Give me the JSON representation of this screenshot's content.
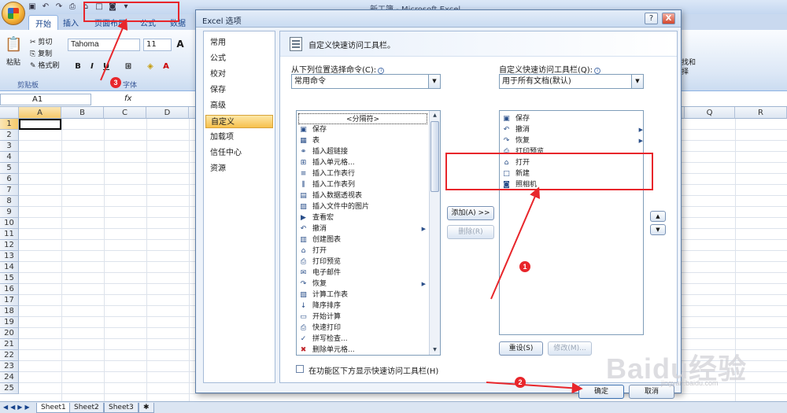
{
  "excel": {
    "title": "新工簿 - Microsoft Excel",
    "tabs": [
      "开始",
      "插入",
      "页面布局",
      "公式",
      "数据"
    ],
    "clipboard": {
      "paste": "粘贴",
      "cut": "剪切",
      "copy": "复制",
      "painter": "格式刷",
      "group": "剪贴板"
    },
    "font": {
      "name": "Tahoma",
      "size": "11",
      "group": "字体"
    },
    "ribbon_right": [
      "找和",
      "择"
    ],
    "name_box": "A1",
    "fx": "fx",
    "columns": [
      "A",
      "B",
      "C",
      "D",
      "Q",
      "R"
    ],
    "rows": [
      "1",
      "2",
      "3",
      "4",
      "5",
      "6",
      "7",
      "8",
      "9",
      "10",
      "11",
      "12",
      "13",
      "14",
      "15",
      "16",
      "17",
      "18",
      "19",
      "20",
      "21",
      "22",
      "23",
      "24",
      "25"
    ],
    "sheets": [
      "Sheet1",
      "Sheet2",
      "Sheet3"
    ]
  },
  "dialog": {
    "title": "Excel 选项",
    "help": "?",
    "close": "X",
    "nav": [
      "常用",
      "公式",
      "校对",
      "保存",
      "高级",
      "自定义",
      "加载项",
      "信任中心",
      "资源"
    ],
    "selected_nav": "自定义",
    "header": "自定义快速访问工具栏。",
    "choose_label": "从下列位置选择命令(C):",
    "choose_value": "常用命令",
    "customize_label": "自定义快速访问工具栏(Q):",
    "customize_value": "用于所有文档(默认)",
    "commands": [
      {
        "label": "<分隔符>",
        "icon": ""
      },
      {
        "label": "保存",
        "icon": "save-icon"
      },
      {
        "label": "表",
        "icon": "table-icon"
      },
      {
        "label": "插入超链接",
        "icon": "hyperlink-icon"
      },
      {
        "label": "插入单元格...",
        "icon": "insert-cells-icon"
      },
      {
        "label": "插入工作表行",
        "icon": "insert-rows-icon"
      },
      {
        "label": "插入工作表列",
        "icon": "insert-columns-icon"
      },
      {
        "label": "插入数据透视表",
        "icon": "pivot-table-icon"
      },
      {
        "label": "插入文件中的图片",
        "icon": "picture-icon"
      },
      {
        "label": "查看宏",
        "icon": "macro-icon"
      },
      {
        "label": "撤消",
        "icon": "undo-icon"
      },
      {
        "label": "创建图表",
        "icon": "chart-icon"
      },
      {
        "label": "打开",
        "icon": "open-folder-icon"
      },
      {
        "label": "打印预览",
        "icon": "print-preview-icon"
      },
      {
        "label": "电子邮件",
        "icon": "email-icon"
      },
      {
        "label": "恢复",
        "icon": "redo-icon"
      },
      {
        "label": "计算工作表",
        "icon": "calc-sheet-icon"
      },
      {
        "label": "降序排序",
        "icon": "sort-desc-icon"
      },
      {
        "label": "开始计算",
        "icon": "calculate-icon"
      },
      {
        "label": "快速打印",
        "icon": "quick-print-icon"
      },
      {
        "label": "拼写检查...",
        "icon": "spellcheck-icon"
      },
      {
        "label": "删除单元格...",
        "icon": "delete-cells-icon"
      }
    ],
    "toolbar_items": [
      {
        "label": "保存",
        "icon": "save-icon"
      },
      {
        "label": "撤消",
        "icon": "undo-icon"
      },
      {
        "label": "恢复",
        "icon": "redo-icon"
      },
      {
        "label": "打印预览",
        "icon": "print-preview-icon"
      },
      {
        "label": "打开",
        "icon": "open-folder-icon"
      },
      {
        "label": "新建",
        "icon": "new-document-icon"
      },
      {
        "label": "照相机",
        "icon": "camera-icon"
      }
    ],
    "add_button": "添加(A) >>",
    "remove_button": "删除(R)",
    "reset_button": "重设(S)",
    "modify_button": "修改(M)...",
    "below_ribbon_checkbox": "在功能区下方显示快速访问工具栏(H)",
    "ok_button": "确定",
    "cancel_button": "取消"
  },
  "annotations": {
    "badge1": "1",
    "badge2": "2",
    "badge3": "3"
  },
  "watermark": {
    "text": "Baidu经验",
    "sub": "jingyan.baidu.com"
  },
  "colors": {
    "annotation_red": "#e8262b",
    "selected_nav": "#f7c14c",
    "ribbon_blue": "#dde8f6"
  }
}
